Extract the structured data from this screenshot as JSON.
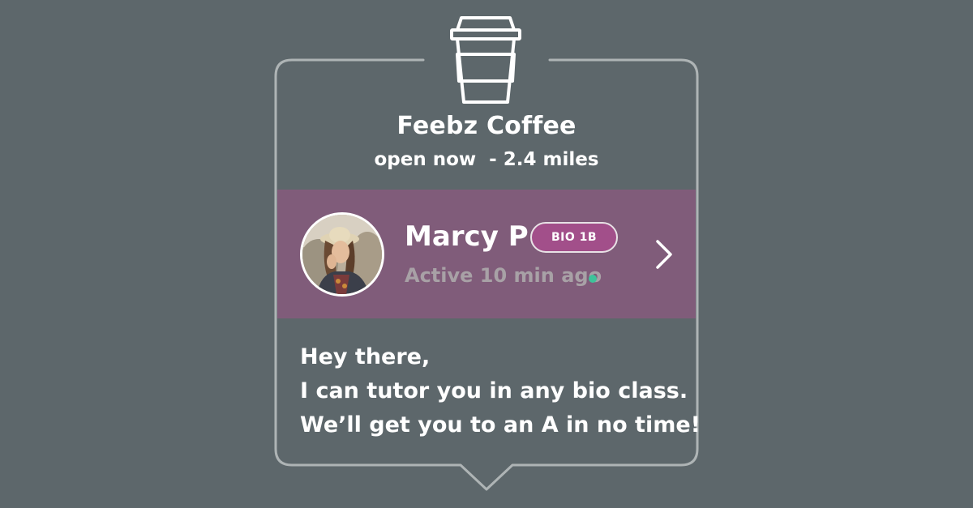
{
  "place": {
    "icon": "coffee-cup-icon",
    "name": "Feebz Coffee",
    "status": "open now  - 2.4 miles"
  },
  "profile": {
    "name": "Marcy P",
    "badge": "BIO 1B",
    "activity": "Active 10 min ago",
    "online": true,
    "avatar_icon": "user-avatar-photo",
    "next_icon": "chevron-right-icon"
  },
  "message": {
    "lines": [
      "Hey there,",
      "I can tutor you in any bio class.",
      "We’ll get you to an A in no time!"
    ]
  },
  "colors": {
    "background": "#5d676b",
    "band": "#805c7a",
    "badge": "#a24f8a",
    "online": "#3ec39a",
    "frame": "#aeb4b5"
  }
}
